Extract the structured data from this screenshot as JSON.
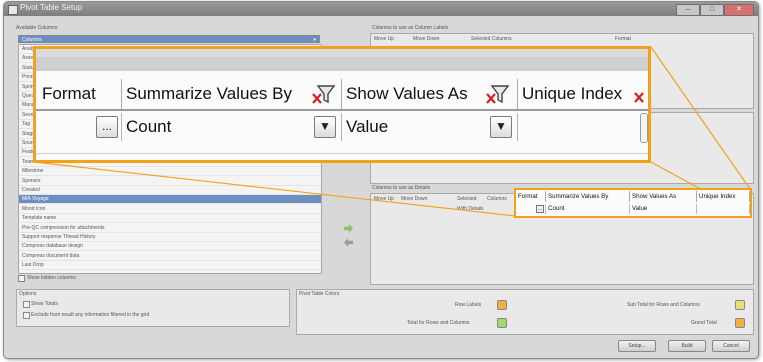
{
  "window": {
    "title": "Pivot Table Setup",
    "minimize": "–",
    "maximize": "□",
    "close": "✕"
  },
  "available_columns": {
    "label": "Available Columns",
    "selected": "Columns",
    "items": [
      "Analyst",
      "Assets",
      "Status",
      "Priority",
      "Sprint",
      "Queue",
      "Manager",
      "Severity",
      "Tag",
      "Stage",
      "Source",
      "Feature",
      "Team",
      "Milestone",
      "Sponsor",
      "Created",
      "MIA Voyage",
      "Mood Icon",
      "Template name",
      "Pre-QC compression for attachments",
      "Support response Thread History",
      "Compress database design",
      "Compress document data",
      "Last Drop"
    ],
    "selected_item_index": 16,
    "show_hidden": "Show hidden columns"
  },
  "labels_panel": {
    "label": "Columns to use as Column Labels",
    "headers": [
      "Move Up",
      "Move Down",
      "Selected Columns",
      "Format"
    ]
  },
  "details_panel": {
    "label": "Columns to use as Details",
    "headers": [
      "Move Up",
      "Move Down",
      "Selected",
      "Columns"
    ],
    "row_text": "With Details"
  },
  "grid": {
    "headers": [
      "Format",
      "Summarize Values By",
      "Show Values As",
      "Unique Index"
    ],
    "row": {
      "format_button": "...",
      "summarize": "Count",
      "show_as": "Value",
      "unique_index": ""
    }
  },
  "options": {
    "label": "Options",
    "show_totals": "Show Totals",
    "exclude": "Exclude from result any information filtered in the grid"
  },
  "colors": {
    "label": "Pivot Table Colors",
    "row_labels": "Row Labels",
    "totals": "Total for Rows and Columns",
    "subtotal": "Sub Total for Rows and Columns",
    "grand_total": "Grand Total",
    "accent": "#f2a21a",
    "swatch_orange": "#f0b040",
    "swatch_yellow": "#e8e070",
    "swatch_green": "#a8d870"
  },
  "buttons": {
    "setup": "Setup...",
    "build": "Build",
    "cancel": "Cancel"
  }
}
